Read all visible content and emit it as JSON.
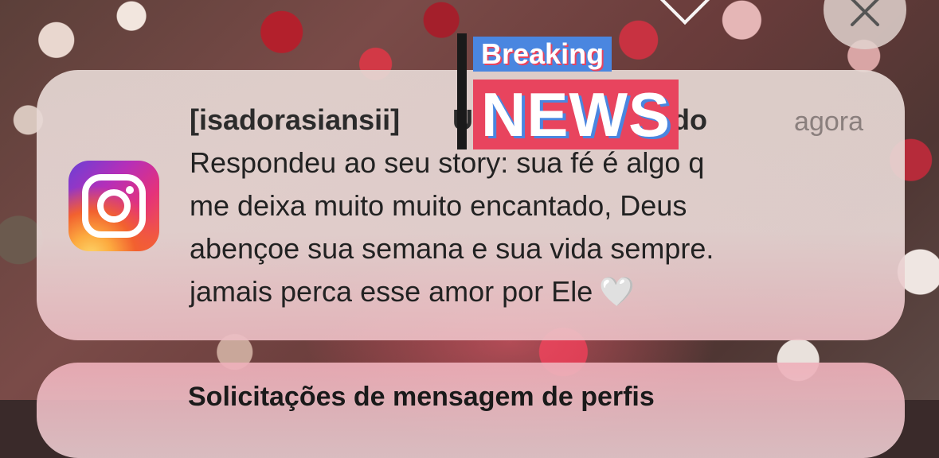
{
  "notification": {
    "app_icon": "instagram-icon",
    "sender": "[isadorasiansii]",
    "sender_hidden_suffix": "U",
    "sender_tail": "do",
    "time": "agora",
    "body_lines": [
      "Respondeu ao seu story: sua fé é algo q",
      "me deixa muito muito encantado, Deus",
      "abençoe sua semana e sua vida sempre.",
      "jamais perca esse amor por Ele"
    ],
    "body_emoji": "🤍"
  },
  "second_notification": {
    "partial_title": "Solicitações de mensagem de perfis"
  },
  "sticker": {
    "top": "Breaking",
    "bottom": "NEWS"
  },
  "controls": {
    "close_icon": "close-icon",
    "chevron_icon": "chevron-down-icon"
  },
  "colors": {
    "sticker_blue": "#4a86e0",
    "sticker_red": "#e8445e"
  }
}
